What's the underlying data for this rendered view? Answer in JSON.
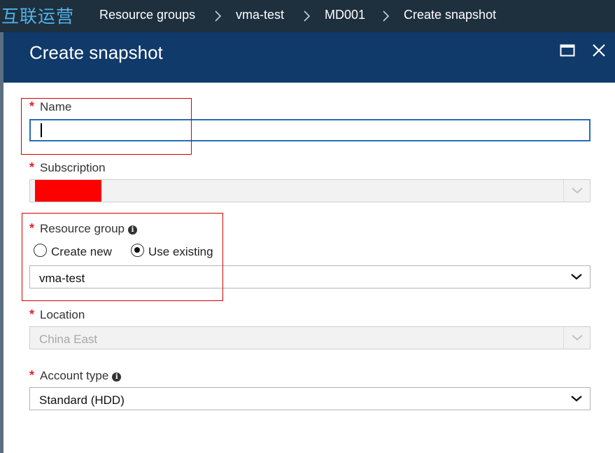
{
  "topbar": {
    "brand": "互联运营",
    "breadcrumbs": [
      "Resource groups",
      "vma-test",
      "MD001",
      "Create snapshot"
    ]
  },
  "blade": {
    "title": "Create snapshot",
    "maximize_icon": "maximize-icon",
    "close_icon": "close-icon"
  },
  "form": {
    "required_marker": "*",
    "name": {
      "label": "Name",
      "value": ""
    },
    "subscription": {
      "label": "Subscription",
      "value": ""
    },
    "resource_group": {
      "label": "Resource group",
      "options": [
        "Create new",
        "Use existing"
      ],
      "selected_option": "Use existing",
      "value": "vma-test"
    },
    "location": {
      "label": "Location",
      "value": "China East"
    },
    "account_type": {
      "label": "Account type",
      "value": "Standard (HDD)"
    }
  },
  "colors": {
    "topbar_bg": "#1e2f3e",
    "brand": "#4fb3ea",
    "blade_header_bg": "#0f3a6a",
    "required": "#e0242f",
    "input_focus_border": "#2a6db5",
    "annotation": "#d00000",
    "redaction": "#ff0000"
  }
}
